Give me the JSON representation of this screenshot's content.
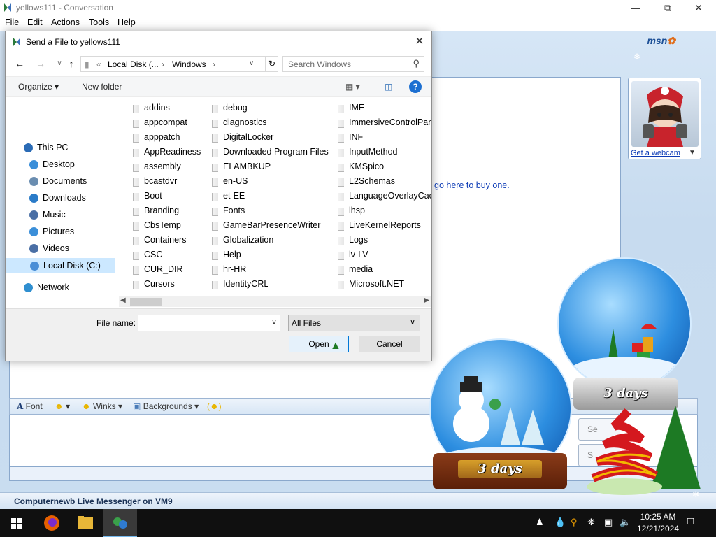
{
  "window": {
    "title": "yellows111 - Conversation",
    "menu": [
      "File",
      "Edit",
      "Actions",
      "Tools",
      "Help"
    ]
  },
  "messenger": {
    "logo": "msn",
    "buy_link": "go here to buy one.",
    "webcam_link": "Get a webcam",
    "toolbar": {
      "font": "Font",
      "winks": "Winks",
      "backgrounds": "Backgrounds"
    },
    "send_btn_1": "Se",
    "send_btn_2": "S",
    "status_bar": "Computernewb Live Messenger on VM9"
  },
  "dialog": {
    "title": "Send a File to yellows111",
    "address": {
      "segments": [
        "Local Disk (...",
        "Windows"
      ]
    },
    "search_placeholder": "Search Windows",
    "commands": {
      "organize": "Organize",
      "new_folder": "New folder"
    },
    "nav_items": [
      {
        "label": "This PC",
        "icon": "pc-icon",
        "level": 0
      },
      {
        "label": "Desktop",
        "icon": "desktop-icon",
        "level": 1
      },
      {
        "label": "Documents",
        "icon": "documents-icon",
        "level": 1
      },
      {
        "label": "Downloads",
        "icon": "downloads-icon",
        "level": 1
      },
      {
        "label": "Music",
        "icon": "music-icon",
        "level": 1
      },
      {
        "label": "Pictures",
        "icon": "pictures-icon",
        "level": 1
      },
      {
        "label": "Videos",
        "icon": "videos-icon",
        "level": 1
      },
      {
        "label": "Local Disk (C:)",
        "icon": "drive-icon",
        "level": 1,
        "selected": true
      },
      {
        "label": "Network",
        "icon": "network-icon",
        "level": 0
      }
    ],
    "files": {
      "col1": [
        "addins",
        "appcompat",
        "apppatch",
        "AppReadiness",
        "assembly",
        "bcastdvr",
        "Boot",
        "Branding",
        "CbsTemp",
        "Containers",
        "CSC",
        "CUR_DIR",
        "Cursors"
      ],
      "col2": [
        "debug",
        "diagnostics",
        "DigitalLocker",
        "Downloaded Program Files",
        "ELAMBKUP",
        "en-US",
        "et-EE",
        "Fonts",
        "GameBarPresenceWriter",
        "Globalization",
        "Help",
        "hr-HR",
        "IdentityCRL"
      ],
      "col3": [
        "IME",
        "ImmersiveControlPanel",
        "INF",
        "InputMethod",
        "KMSpico",
        "L2Schemas",
        "LanguageOverlayCache",
        "lhsp",
        "LiveKernelReports",
        "Logs",
        "lv-LV",
        "media",
        "Microsoft.NET"
      ]
    },
    "file_name_label": "File name:",
    "file_name_value": "",
    "filter": "All Files",
    "open_label": "Open",
    "cancel_label": "Cancel"
  },
  "decorations": {
    "globe_label_1": "3 days",
    "globe_label_2": "3 days"
  },
  "taskbar": {
    "time": "10:25 AM",
    "date": "12/21/2024"
  },
  "colors": {
    "accent": "#0078d7",
    "link": "#0c3bb6",
    "selection": "#cce8ff",
    "taskbar": "#101010"
  }
}
